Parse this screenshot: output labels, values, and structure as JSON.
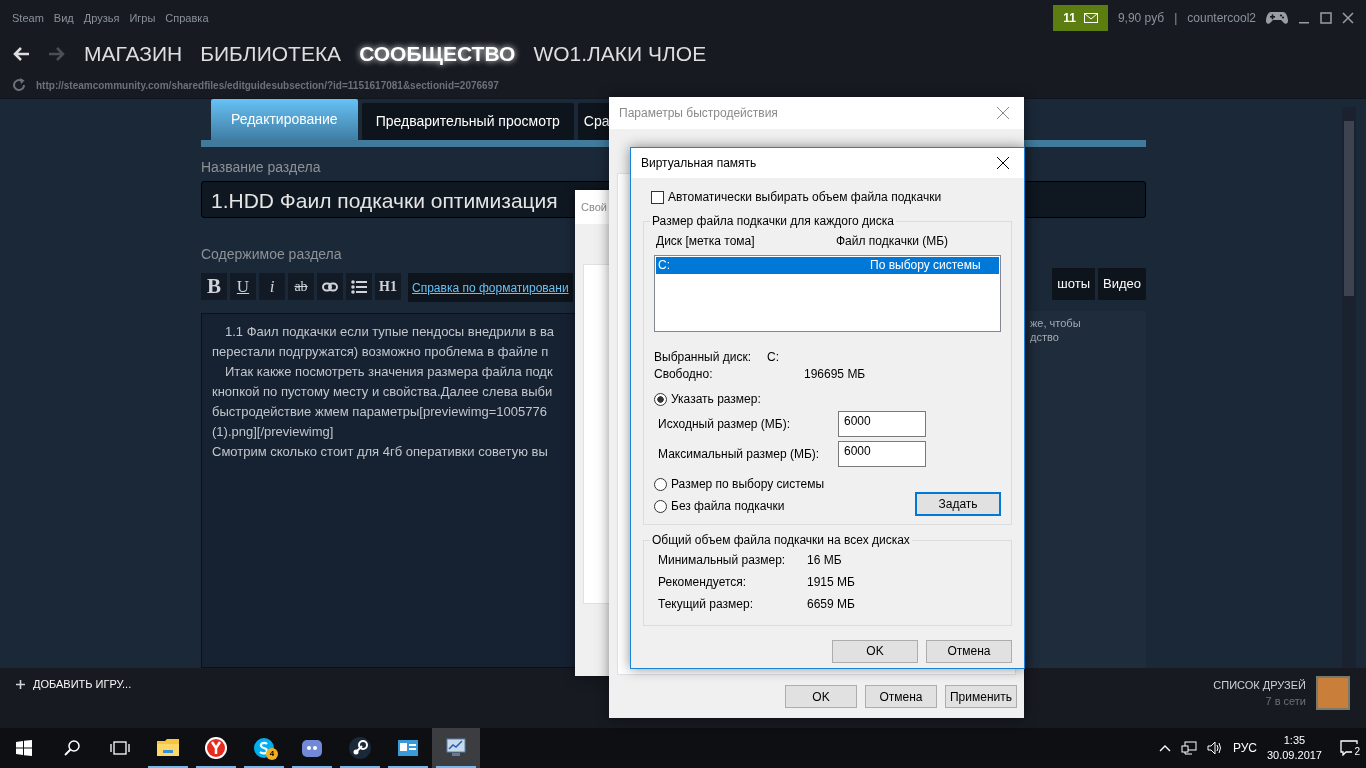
{
  "menu": [
    "Steam",
    "Вид",
    "Друзья",
    "Игры",
    "Справка"
  ],
  "account": {
    "notifications": "11",
    "balance": "9,90 руб",
    "separator": "|",
    "username": "countercool2"
  },
  "nav": [
    {
      "label": "МАГАЗИН",
      "selected": false
    },
    {
      "label": "БИБЛИОТЕКА",
      "selected": false
    },
    {
      "label": "СООБЩЕСТВО",
      "selected": true
    },
    {
      "label": "WO1.ЛАКИ ЧЛОЕ",
      "selected": false
    }
  ],
  "url": "http://steamcommunity.com/sharedfiles/editguidesubsection/?id=1151617081&sectionid=2076697",
  "editor": {
    "tabs": [
      {
        "label": "Редактирование",
        "selected": true
      },
      {
        "label": "Предварительный просмотр",
        "selected": false
      },
      {
        "label": "Сра",
        "selected": false
      }
    ],
    "title_label": "Название раздела",
    "title_value": "1.HDD Фаил подкачки оптимизация",
    "content_label": "Содержимое раздела",
    "toolbar": [
      {
        "kind": "bold",
        "label": "B"
      },
      {
        "kind": "underline",
        "label": "U"
      },
      {
        "kind": "italic",
        "label": "i"
      },
      {
        "kind": "strike",
        "label": "ab"
      },
      {
        "kind": "link"
      },
      {
        "kind": "list"
      },
      {
        "kind": "heading",
        "label": "H1"
      }
    ],
    "help_link": "Справка по форматировани",
    "body_lines": [
      {
        "text": "1.1 Фаил подкачки если тупые пендосы внедрили в ва",
        "indent": true
      },
      {
        "text": "перестали подгружатся) возможно проблема в файле п",
        "indent": false
      },
      {
        "text": "Итак какже посмотреть значения размера файла подк",
        "indent": true
      },
      {
        "text": "кнопкой по пустому месту и свойства.Далее слева выби",
        "indent": false
      },
      {
        "text": "быстродействие жмем параметры[previewimg=1005776",
        "indent": false
      },
      {
        "text": "(1).png][/previewimg]",
        "indent": false
      },
      {
        "text": "Смотрим сколько стоит для 4гб оперативки советую вы",
        "indent": false
      }
    ],
    "media_tabs": [
      {
        "label": "шоты",
        "selected": false
      },
      {
        "label": "Видео",
        "selected": false
      }
    ],
    "media_text": [
      "же, чтобы",
      "дство"
    ]
  },
  "footer": {
    "add_game": "ДОБАВИТЬ ИГРУ...",
    "friends": "СПИСОК ДРУЗЕЙ",
    "online": "7 в сети"
  },
  "properties_window": {
    "title": "Свой"
  },
  "performance_window": {
    "title": "Параметры быстродействия",
    "buttons": [
      "OK",
      "Отмена",
      "Применить"
    ]
  },
  "virtual_memory": {
    "title": "Виртуальная память",
    "auto": {
      "label": "Автоматически выбирать объем файла подкачки",
      "checked": false
    },
    "per_disk": {
      "title": "Размер файла подкачки для каждого диска",
      "columns": [
        "Диск [метка тома]",
        "Файл подкачки (МБ)"
      ],
      "rows": [
        {
          "drive": "C:",
          "size": "По выбору системы",
          "selected": true
        }
      ],
      "selected_label": "Выбранный диск:",
      "selected_value": "C:",
      "free_label": "Свободно:",
      "free_value": "196695 МБ",
      "options": [
        {
          "kind": "custom",
          "label": "Указать размер:",
          "selected": true
        },
        {
          "kind": "system",
          "label": "Размер по выбору системы",
          "selected": false
        },
        {
          "kind": "none",
          "label": "Без файла подкачки",
          "selected": false
        }
      ],
      "fields": [
        {
          "label": "Исходный размер (МБ):",
          "value": "6000"
        },
        {
          "label": "Максимальный размер (МБ):",
          "value": "6000"
        }
      ],
      "set_button": "Задать"
    },
    "totals": {
      "title": "Общий объем файла подкачки на всех дисках",
      "rows": [
        {
          "label": "Минимальный размер:",
          "value": "16 МБ"
        },
        {
          "label": "Рекомендуется:",
          "value": "1915 МБ"
        },
        {
          "label": "Текущий размер:",
          "value": "6659 МБ"
        }
      ]
    },
    "buttons": [
      "OK",
      "Отмена"
    ]
  },
  "taskbar": {
    "apps": [
      {
        "kind": "folder",
        "selected": false
      },
      {
        "kind": "browser",
        "selected": false
      },
      {
        "kind": "chat",
        "selected": false,
        "badge": "4"
      },
      {
        "kind": "voice",
        "selected": false
      },
      {
        "kind": "steam",
        "selected": false
      },
      {
        "kind": "card",
        "selected": false
      },
      {
        "kind": "monitor",
        "selected": true
      }
    ],
    "language": "РУС",
    "time": "1:35",
    "date": "30.09.2017",
    "notifications": "2"
  }
}
